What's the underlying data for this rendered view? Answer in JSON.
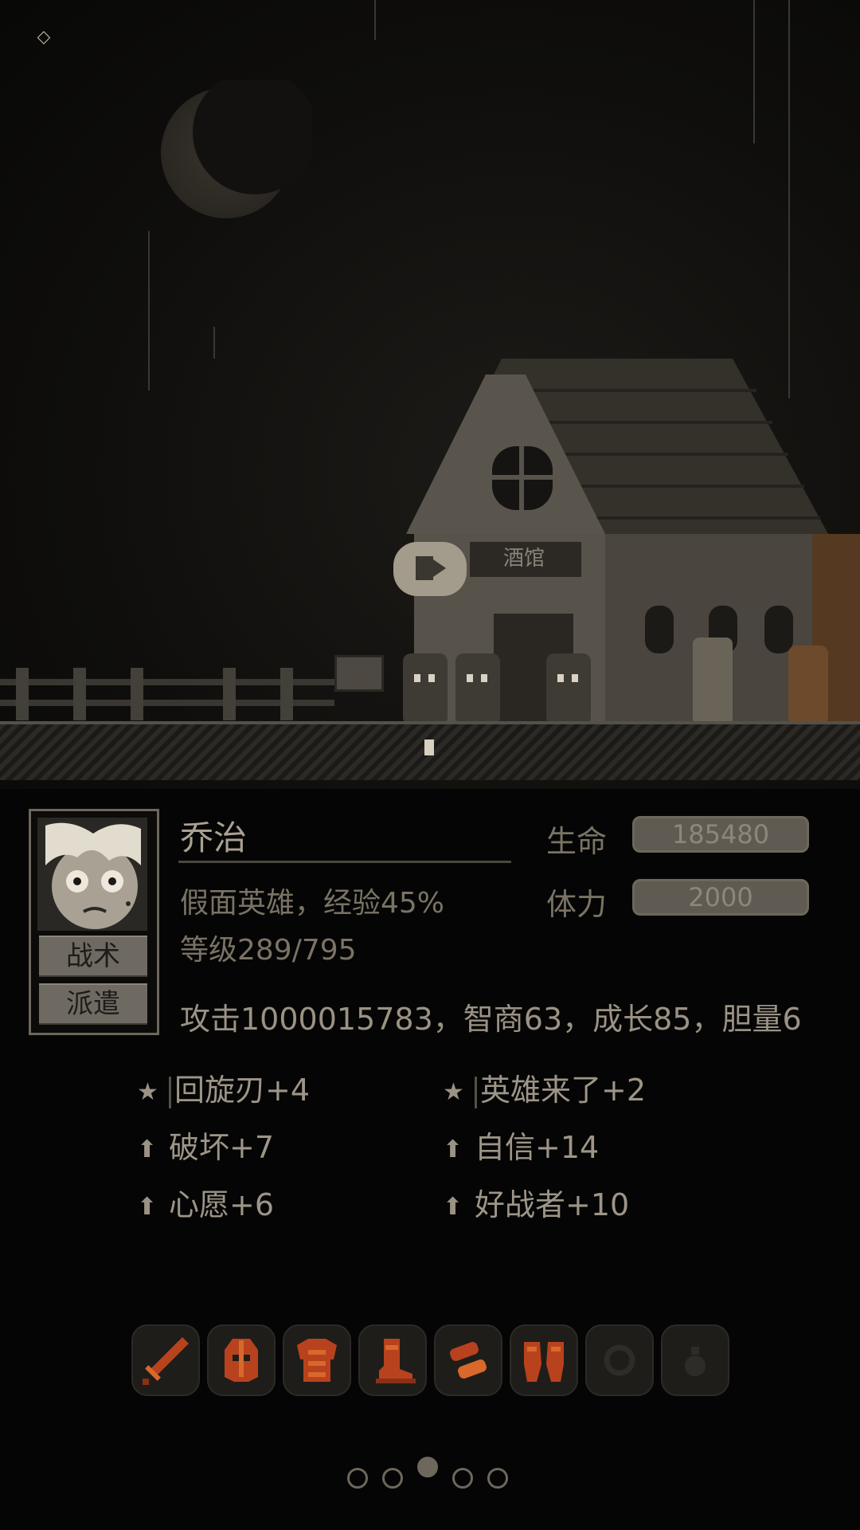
{
  "character": {
    "name": "乔治",
    "class_exp": "假面英雄，经验45%",
    "level": "等级289/795",
    "hp_label": "生命",
    "hp_value": "185480",
    "stamina_label": "体力",
    "stamina_value": "2000",
    "attributes": "攻击1000015783，智商63，成长85，胆量6"
  },
  "portrait_buttons": {
    "tactics": "战术",
    "dispatch": "派遣"
  },
  "skills": [
    {
      "icon": "star-icon",
      "label": "回旋刃+4"
    },
    {
      "icon": "star-icon",
      "label": "英雄来了+2"
    },
    {
      "icon": "arrow-up-icon",
      "label": "破坏+7"
    },
    {
      "icon": "arrow-up-icon",
      "label": "自信+14"
    },
    {
      "icon": "arrow-up-icon",
      "label": "心愿+6"
    },
    {
      "icon": "arrow-up-icon",
      "label": "好战者+10"
    }
  ],
  "equipment": [
    {
      "icon": "sword-icon",
      "filled": true
    },
    {
      "icon": "helmet-icon",
      "filled": true
    },
    {
      "icon": "armor-icon",
      "filled": true
    },
    {
      "icon": "boots-icon",
      "filled": true
    },
    {
      "icon": "bracers-icon",
      "filled": true
    },
    {
      "icon": "gauntlets-icon",
      "filled": true
    },
    {
      "icon": "ring-slot-icon",
      "filled": false
    },
    {
      "icon": "potion-slot-icon",
      "filled": false
    }
  ],
  "pagination": {
    "total": 5,
    "active": 2
  },
  "scene": {
    "sign_text": "酒馆"
  },
  "colors": {
    "equipment_red": "#b8421e",
    "equipment_orange": "#d9682b",
    "ui_tan": "#9a9284",
    "bar_fill": "#5f5b53"
  }
}
